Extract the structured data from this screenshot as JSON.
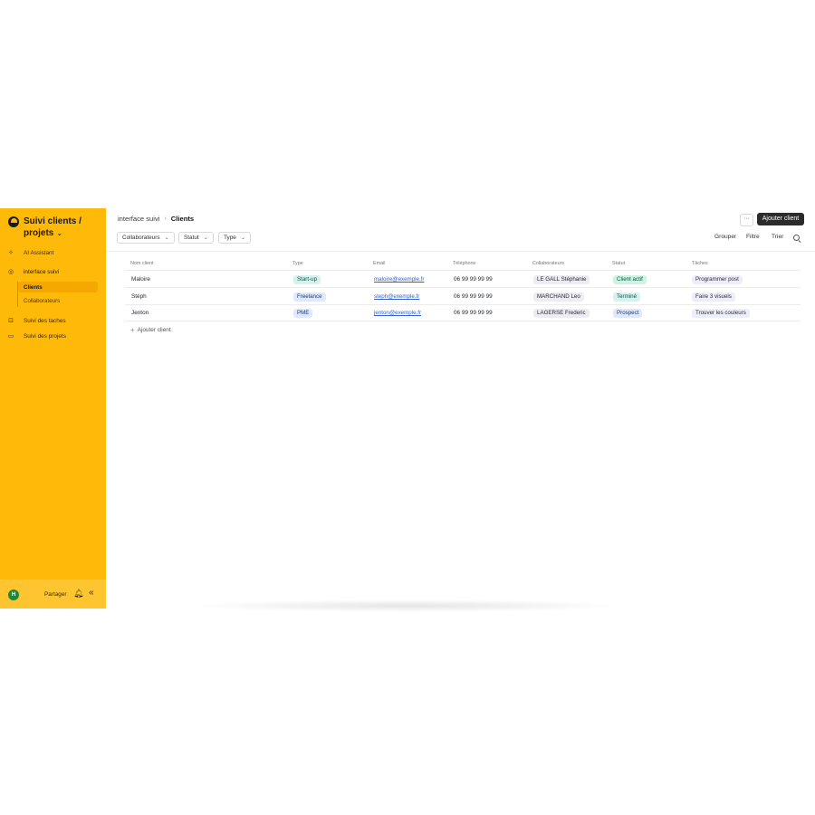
{
  "workspace": {
    "title": "Suivi clients / projets",
    "chevron": "⌄"
  },
  "sidebar": {
    "items": [
      {
        "label": "AI Assistant",
        "icon": "sparkle-icon"
      },
      {
        "label": "interface suivi",
        "icon": "globe-icon"
      },
      {
        "label": "Clients"
      },
      {
        "label": "Collaborateurs"
      },
      {
        "label": "Suivi des taches",
        "icon": "lock-icon"
      },
      {
        "label": "Suivi des projets",
        "icon": "table-icon"
      }
    ],
    "footer": {
      "avatar_initial": "H",
      "share_label": "Partager"
    }
  },
  "header": {
    "breadcrumb": [
      "interface suivi",
      "Clients"
    ],
    "more_label": "···",
    "add_button": "Ajouter client"
  },
  "toolbar": {
    "filters": [
      "Collaborateurs",
      "Statut",
      "Type"
    ],
    "group": "Grouper",
    "filter": "Filtre",
    "sort": "Trier"
  },
  "table": {
    "columns": [
      "Nom client",
      "Type",
      "Email",
      "Téléphone",
      "Collaborateurs",
      "Statut",
      "Tâches"
    ],
    "rows": [
      {
        "name": "Maloire",
        "type": "Start-up",
        "email": "maloire@exemple.fr",
        "phone": "06 99 99 99 99",
        "collab": "LE GALL Stéphanie",
        "status": "Client actif",
        "task": "Programmer post"
      },
      {
        "name": "Stéph",
        "type": "Freelance",
        "email": "steph@exemple.fr",
        "phone": "06 99 99 99 99",
        "collab": "MARCHAND Leo",
        "status": "Terminé",
        "task": "Faire 3 visuels"
      },
      {
        "name": "Jenton",
        "type": "PME",
        "email": "jenton@exemple.fr",
        "phone": "06 99 99 99 99",
        "collab": "LAGERSE Frederic",
        "status": "Prospect",
        "task": "Trouver les couleurs"
      }
    ],
    "add_row_label": "Ajouter client"
  },
  "colors": {
    "sidebar": "#FFB908",
    "accent_dark": "#2b2b2b",
    "link": "#2f5fd0"
  }
}
